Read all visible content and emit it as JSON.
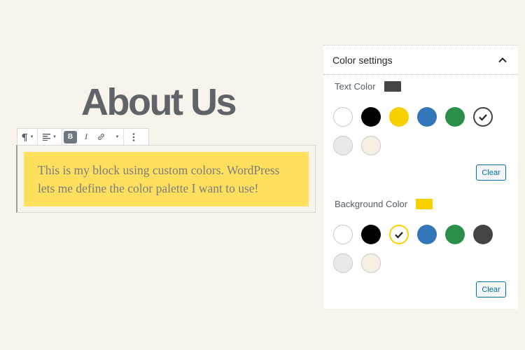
{
  "editor": {
    "heading": "About Us",
    "paragraph": "This is my block using custom colors. WordPress lets me define the color palette I want to use!",
    "toolbar": {
      "paragraph_icon": "paragraph-icon",
      "align_icon": "align-left-icon",
      "bold_label": "B",
      "italic_label": "I",
      "link_icon": "link-icon",
      "more_icon": "more-vertical-icon"
    }
  },
  "panel": {
    "title": "Color settings",
    "text_color": {
      "label": "Text Color",
      "current": "#444444",
      "selected": "#444444",
      "clear_label": "Clear"
    },
    "background_color": {
      "label": "Background Color",
      "current": "#f8d000",
      "selected": "#f8d000",
      "clear_label": "Clear"
    },
    "palette": [
      "#ffffff",
      "#000000",
      "#f8d000",
      "#3276b9",
      "#2b8f4a",
      "#444444",
      "#e9e9e9",
      "#f5f0e2"
    ]
  },
  "colors": {
    "page_bg": "#f8f4ec",
    "block_bg": "#ffdf5e",
    "accent": "#0071a1"
  }
}
